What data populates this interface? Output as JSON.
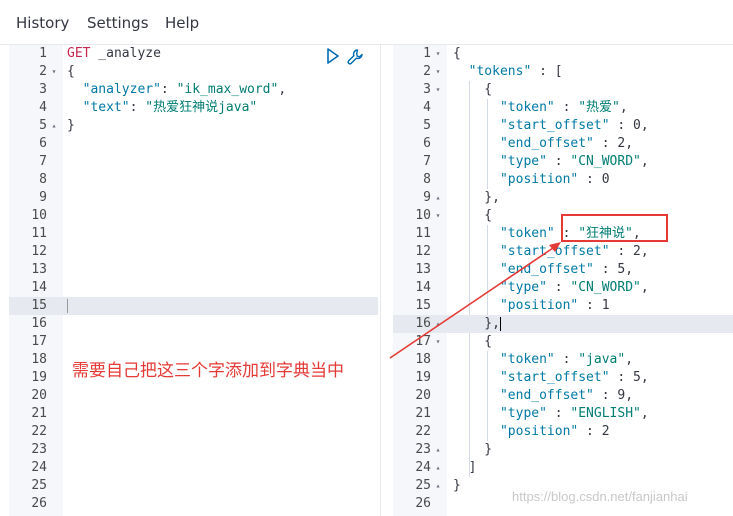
{
  "menu": {
    "history": "History",
    "settings": "Settings",
    "help": "Help"
  },
  "request": {
    "lines": [
      {
        "n": "1",
        "fold": "",
        "parts": [
          [
            "k-method",
            "GET"
          ],
          [
            "k-url",
            " _analyze"
          ]
        ]
      },
      {
        "n": "2",
        "fold": "▾",
        "parts": [
          [
            "k-punc",
            "{"
          ]
        ]
      },
      {
        "n": "3",
        "fold": "",
        "parts": [
          [
            "k-key",
            "  \"analyzer\""
          ],
          [
            "k-punc",
            ": "
          ],
          [
            "k-str",
            "\"ik_max_word\""
          ],
          [
            "k-punc",
            ","
          ]
        ]
      },
      {
        "n": "4",
        "fold": "",
        "parts": [
          [
            "k-key",
            "  \"text\""
          ],
          [
            "k-punc",
            ": "
          ],
          [
            "k-str",
            "\"热爱狂神说java\""
          ]
        ]
      },
      {
        "n": "5",
        "fold": "▴",
        "parts": [
          [
            "k-punc",
            "}"
          ]
        ]
      },
      {
        "n": "6",
        "fold": "",
        "parts": []
      },
      {
        "n": "7",
        "fold": "",
        "parts": []
      },
      {
        "n": "8",
        "fold": "",
        "parts": []
      },
      {
        "n": "9",
        "fold": "",
        "parts": []
      },
      {
        "n": "10",
        "fold": "",
        "parts": []
      },
      {
        "n": "11",
        "fold": "",
        "parts": []
      },
      {
        "n": "12",
        "fold": "",
        "parts": []
      },
      {
        "n": "13",
        "fold": "",
        "parts": []
      },
      {
        "n": "14",
        "fold": "",
        "parts": []
      },
      {
        "n": "15",
        "fold": "",
        "parts": [],
        "active": true
      },
      {
        "n": "16",
        "fold": "",
        "parts": []
      },
      {
        "n": "17",
        "fold": "",
        "parts": []
      },
      {
        "n": "18",
        "fold": "",
        "parts": []
      },
      {
        "n": "19",
        "fold": "",
        "parts": []
      },
      {
        "n": "20",
        "fold": "",
        "parts": []
      },
      {
        "n": "21",
        "fold": "",
        "parts": []
      },
      {
        "n": "22",
        "fold": "",
        "parts": []
      },
      {
        "n": "23",
        "fold": "",
        "parts": []
      },
      {
        "n": "24",
        "fold": "",
        "parts": []
      },
      {
        "n": "25",
        "fold": "",
        "parts": []
      },
      {
        "n": "26",
        "fold": "",
        "parts": []
      }
    ]
  },
  "response": {
    "lines": [
      {
        "n": "1",
        "fold": "▾",
        "parts": [
          [
            "k-punc",
            "{"
          ]
        ]
      },
      {
        "n": "2",
        "fold": "▾",
        "parts": [
          [
            "k-key",
            "  \"tokens\""
          ],
          [
            "k-punc",
            " : ["
          ]
        ]
      },
      {
        "n": "3",
        "fold": "▾",
        "parts": [
          [
            "k-punc",
            "    {"
          ]
        ]
      },
      {
        "n": "4",
        "fold": "",
        "parts": [
          [
            "k-key",
            "      \"token\""
          ],
          [
            "k-punc",
            " : "
          ],
          [
            "k-str",
            "\"热爱\""
          ],
          [
            "k-punc",
            ","
          ]
        ]
      },
      {
        "n": "5",
        "fold": "",
        "parts": [
          [
            "k-key",
            "      \"start_offset\""
          ],
          [
            "k-punc",
            " : "
          ],
          [
            "k-num",
            "0"
          ],
          [
            "k-punc",
            ","
          ]
        ]
      },
      {
        "n": "6",
        "fold": "",
        "parts": [
          [
            "k-key",
            "      \"end_offset\""
          ],
          [
            "k-punc",
            " : "
          ],
          [
            "k-num",
            "2"
          ],
          [
            "k-punc",
            ","
          ]
        ]
      },
      {
        "n": "7",
        "fold": "",
        "parts": [
          [
            "k-key",
            "      \"type\""
          ],
          [
            "k-punc",
            " : "
          ],
          [
            "k-str",
            "\"CN_WORD\""
          ],
          [
            "k-punc",
            ","
          ]
        ]
      },
      {
        "n": "8",
        "fold": "",
        "parts": [
          [
            "k-key",
            "      \"position\""
          ],
          [
            "k-punc",
            " : "
          ],
          [
            "k-num",
            "0"
          ]
        ]
      },
      {
        "n": "9",
        "fold": "▴",
        "parts": [
          [
            "k-punc",
            "    },"
          ]
        ]
      },
      {
        "n": "10",
        "fold": "▾",
        "parts": [
          [
            "k-punc",
            "    {"
          ]
        ]
      },
      {
        "n": "11",
        "fold": "",
        "parts": [
          [
            "k-key",
            "      \"token\""
          ],
          [
            "k-punc",
            " : "
          ],
          [
            "k-str",
            "\"狂神说\""
          ],
          [
            "k-punc",
            ","
          ]
        ]
      },
      {
        "n": "12",
        "fold": "",
        "parts": [
          [
            "k-key",
            "      \"start_offset\""
          ],
          [
            "k-punc",
            " : "
          ],
          [
            "k-num",
            "2"
          ],
          [
            "k-punc",
            ","
          ]
        ]
      },
      {
        "n": "13",
        "fold": "",
        "parts": [
          [
            "k-key",
            "      \"end_offset\""
          ],
          [
            "k-punc",
            " : "
          ],
          [
            "k-num",
            "5"
          ],
          [
            "k-punc",
            ","
          ]
        ]
      },
      {
        "n": "14",
        "fold": "",
        "parts": [
          [
            "k-key",
            "      \"type\""
          ],
          [
            "k-punc",
            " : "
          ],
          [
            "k-str",
            "\"CN_WORD\""
          ],
          [
            "k-punc",
            ","
          ]
        ]
      },
      {
        "n": "15",
        "fold": "",
        "parts": [
          [
            "k-key",
            "      \"position\""
          ],
          [
            "k-punc",
            " : "
          ],
          [
            "k-num",
            "1"
          ]
        ]
      },
      {
        "n": "16",
        "fold": "▴",
        "parts": [
          [
            "k-punc",
            "    },"
          ]
        ],
        "active": true,
        "caret": true
      },
      {
        "n": "17",
        "fold": "▾",
        "parts": [
          [
            "k-punc",
            "    {"
          ]
        ]
      },
      {
        "n": "18",
        "fold": "",
        "parts": [
          [
            "k-key",
            "      \"token\""
          ],
          [
            "k-punc",
            " : "
          ],
          [
            "k-str",
            "\"java\""
          ],
          [
            "k-punc",
            ","
          ]
        ]
      },
      {
        "n": "19",
        "fold": "",
        "parts": [
          [
            "k-key",
            "      \"start_offset\""
          ],
          [
            "k-punc",
            " : "
          ],
          [
            "k-num",
            "5"
          ],
          [
            "k-punc",
            ","
          ]
        ]
      },
      {
        "n": "20",
        "fold": "",
        "parts": [
          [
            "k-key",
            "      \"end_offset\""
          ],
          [
            "k-punc",
            " : "
          ],
          [
            "k-num",
            "9"
          ],
          [
            "k-punc",
            ","
          ]
        ]
      },
      {
        "n": "21",
        "fold": "",
        "parts": [
          [
            "k-key",
            "      \"type\""
          ],
          [
            "k-punc",
            " : "
          ],
          [
            "k-str",
            "\"ENGLISH\""
          ],
          [
            "k-punc",
            ","
          ]
        ]
      },
      {
        "n": "22",
        "fold": "",
        "parts": [
          [
            "k-key",
            "      \"position\""
          ],
          [
            "k-punc",
            " : "
          ],
          [
            "k-num",
            "2"
          ]
        ]
      },
      {
        "n": "23",
        "fold": "▴",
        "parts": [
          [
            "k-punc",
            "    }"
          ]
        ]
      },
      {
        "n": "24",
        "fold": "▴",
        "parts": [
          [
            "k-punc",
            "  ]"
          ]
        ]
      },
      {
        "n": "25",
        "fold": "▴",
        "parts": [
          [
            "k-punc",
            "}"
          ]
        ]
      },
      {
        "n": "26",
        "fold": "",
        "parts": []
      }
    ]
  },
  "annotation": {
    "note": "需要自己把这三个字添加到字典当中",
    "color": "#e53935"
  },
  "watermark": "https://blog.csdn.net/fanjianhai",
  "icons": {
    "run": "play-icon",
    "settings": "wrench-icon"
  }
}
